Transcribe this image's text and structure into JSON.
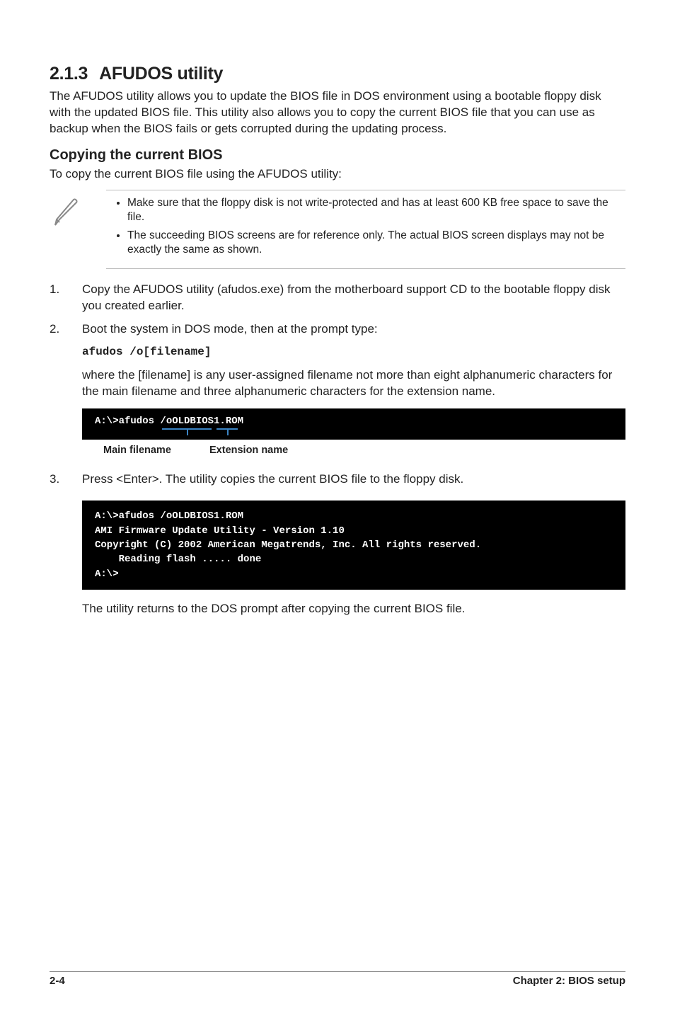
{
  "heading": {
    "number": "2.1.3",
    "title": "AFUDOS utility"
  },
  "intro": "The AFUDOS utility allows you to update the BIOS file in DOS environment using a bootable floppy disk with the updated BIOS file. This utility also allows you to copy the current BIOS file that you can use as backup when the BIOS fails or gets corrupted during the updating process.",
  "copy_heading": "Copying the current BIOS",
  "copy_intro": "To copy the current BIOS file using the AFUDOS utility:",
  "notes": [
    "Make sure that the floppy disk is not write-protected and has at least 600 KB free space to save the file.",
    "The succeeding BIOS screens are for reference only. The actual BIOS screen displays may not be exactly the same as shown."
  ],
  "steps": {
    "s1_num": "1.",
    "s1": "Copy the AFUDOS utility (afudos.exe) from the motherboard support CD to the bootable floppy disk you created earlier.",
    "s2_num": "2.",
    "s2": "Boot the system in DOS mode, then at the prompt type:",
    "s2_cmd": "afudos /o[filename]",
    "s2_desc": "where the [filename] is any user-assigned filename not more than eight alphanumeric characters  for the main filename and three alphanumeric characters for the extension name.",
    "s3_num": "3.",
    "s3": "Press <Enter>. The utility copies the current BIOS file to the floppy disk.",
    "s3_after": "The utility returns to the DOS prompt after copying the current BIOS file."
  },
  "terminal1": "A:\\>afudos /oOLDBIOS1.ROM",
  "labels": {
    "main": "Main filename",
    "ext": "Extension name"
  },
  "terminal2": "A:\\>afudos /oOLDBIOS1.ROM\nAMI Firmware Update Utility - Version 1.10\nCopyright (C) 2002 American Megatrends, Inc. All rights reserved.\n    Reading flash ..... done\nA:\\>",
  "footer": {
    "page": "2-4",
    "chapter": "Chapter 2: BIOS setup"
  }
}
